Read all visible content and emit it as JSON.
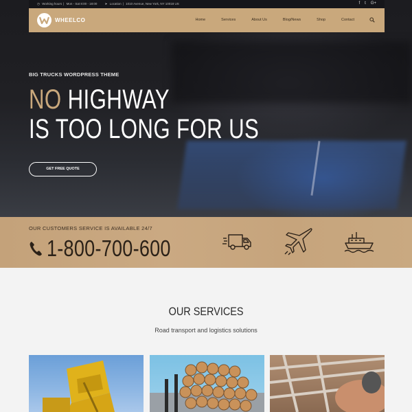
{
  "topbar": {
    "hours_label": "Working hours",
    "hours_value": "Mon - Sat 8:00 - 18:00",
    "location_label": "Location",
    "location_value": "1010 Avenue, New York, NY 10018 US",
    "social": [
      {
        "label": "f",
        "icon": "facebook-icon"
      },
      {
        "label": "t",
        "icon": "twitter-icon"
      },
      {
        "label": "G+",
        "icon": "google-plus-icon"
      }
    ]
  },
  "brand": {
    "name": "WHEELCO"
  },
  "nav": {
    "items": [
      "Home",
      "Services",
      "About Us",
      "Blog/News",
      "Shop",
      "Contact"
    ]
  },
  "hero": {
    "eyebrow": "BIG TRUCKS WORDPRESS THEME",
    "headline_accent": "NO",
    "headline_rest": " HIGHWAY",
    "headline_line2": "IS TOO LONG FOR US",
    "cta_label": "GET FREE QUOTE"
  },
  "contact": {
    "availability": "OUR CUSTOMERS SERVICE IS AVAILABLE 24/7",
    "phone": "1-800-700-600",
    "icons": [
      "truck-icon",
      "airplane-icon",
      "ship-icon"
    ]
  },
  "services": {
    "title": "OUR SERVICES",
    "subtitle": "Road transport and logistics solutions",
    "cards": [
      "dump-truck-image",
      "timber-logs-image",
      "industrial-pipes-image"
    ]
  },
  "colors": {
    "accent": "#c9a87c",
    "dark": "#16161a",
    "text_dark": "#2b2118"
  }
}
